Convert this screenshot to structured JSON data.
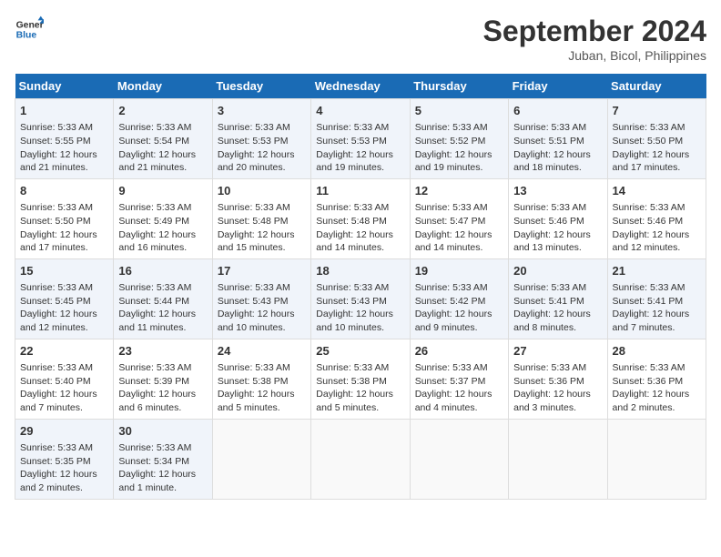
{
  "header": {
    "logo_line1": "General",
    "logo_line2": "Blue",
    "title": "September 2024",
    "subtitle": "Juban, Bicol, Philippines"
  },
  "calendar": {
    "days_of_week": [
      "Sunday",
      "Monday",
      "Tuesday",
      "Wednesday",
      "Thursday",
      "Friday",
      "Saturday"
    ],
    "weeks": [
      [
        null,
        {
          "day": "2",
          "sunrise": "Sunrise: 5:33 AM",
          "sunset": "Sunset: 5:54 PM",
          "daylight": "Daylight: 12 hours and 21 minutes."
        },
        {
          "day": "3",
          "sunrise": "Sunrise: 5:33 AM",
          "sunset": "Sunset: 5:53 PM",
          "daylight": "Daylight: 12 hours and 20 minutes."
        },
        {
          "day": "4",
          "sunrise": "Sunrise: 5:33 AM",
          "sunset": "Sunset: 5:53 PM",
          "daylight": "Daylight: 12 hours and 19 minutes."
        },
        {
          "day": "5",
          "sunrise": "Sunrise: 5:33 AM",
          "sunset": "Sunset: 5:52 PM",
          "daylight": "Daylight: 12 hours and 19 minutes."
        },
        {
          "day": "6",
          "sunrise": "Sunrise: 5:33 AM",
          "sunset": "Sunset: 5:51 PM",
          "daylight": "Daylight: 12 hours and 18 minutes."
        },
        {
          "day": "7",
          "sunrise": "Sunrise: 5:33 AM",
          "sunset": "Sunset: 5:50 PM",
          "daylight": "Daylight: 12 hours and 17 minutes."
        }
      ],
      [
        {
          "day": "1",
          "sunrise": "Sunrise: 5:33 AM",
          "sunset": "Sunset: 5:55 PM",
          "daylight": "Daylight: 12 hours and 21 minutes."
        },
        {
          "day": "9",
          "sunrise": "Sunrise: 5:33 AM",
          "sunset": "Sunset: 5:49 PM",
          "daylight": "Daylight: 12 hours and 16 minutes."
        },
        {
          "day": "10",
          "sunrise": "Sunrise: 5:33 AM",
          "sunset": "Sunset: 5:48 PM",
          "daylight": "Daylight: 12 hours and 15 minutes."
        },
        {
          "day": "11",
          "sunrise": "Sunrise: 5:33 AM",
          "sunset": "Sunset: 5:48 PM",
          "daylight": "Daylight: 12 hours and 14 minutes."
        },
        {
          "day": "12",
          "sunrise": "Sunrise: 5:33 AM",
          "sunset": "Sunset: 5:47 PM",
          "daylight": "Daylight: 12 hours and 14 minutes."
        },
        {
          "day": "13",
          "sunrise": "Sunrise: 5:33 AM",
          "sunset": "Sunset: 5:46 PM",
          "daylight": "Daylight: 12 hours and 13 minutes."
        },
        {
          "day": "14",
          "sunrise": "Sunrise: 5:33 AM",
          "sunset": "Sunset: 5:46 PM",
          "daylight": "Daylight: 12 hours and 12 minutes."
        }
      ],
      [
        {
          "day": "8",
          "sunrise": "Sunrise: 5:33 AM",
          "sunset": "Sunset: 5:50 PM",
          "daylight": "Daylight: 12 hours and 17 minutes."
        },
        {
          "day": "16",
          "sunrise": "Sunrise: 5:33 AM",
          "sunset": "Sunset: 5:44 PM",
          "daylight": "Daylight: 12 hours and 11 minutes."
        },
        {
          "day": "17",
          "sunrise": "Sunrise: 5:33 AM",
          "sunset": "Sunset: 5:43 PM",
          "daylight": "Daylight: 12 hours and 10 minutes."
        },
        {
          "day": "18",
          "sunrise": "Sunrise: 5:33 AM",
          "sunset": "Sunset: 5:43 PM",
          "daylight": "Daylight: 12 hours and 10 minutes."
        },
        {
          "day": "19",
          "sunrise": "Sunrise: 5:33 AM",
          "sunset": "Sunset: 5:42 PM",
          "daylight": "Daylight: 12 hours and 9 minutes."
        },
        {
          "day": "20",
          "sunrise": "Sunrise: 5:33 AM",
          "sunset": "Sunset: 5:41 PM",
          "daylight": "Daylight: 12 hours and 8 minutes."
        },
        {
          "day": "21",
          "sunrise": "Sunrise: 5:33 AM",
          "sunset": "Sunset: 5:41 PM",
          "daylight": "Daylight: 12 hours and 7 minutes."
        }
      ],
      [
        {
          "day": "15",
          "sunrise": "Sunrise: 5:33 AM",
          "sunset": "Sunset: 5:45 PM",
          "daylight": "Daylight: 12 hours and 12 minutes."
        },
        {
          "day": "23",
          "sunrise": "Sunrise: 5:33 AM",
          "sunset": "Sunset: 5:39 PM",
          "daylight": "Daylight: 12 hours and 6 minutes."
        },
        {
          "day": "24",
          "sunrise": "Sunrise: 5:33 AM",
          "sunset": "Sunset: 5:38 PM",
          "daylight": "Daylight: 12 hours and 5 minutes."
        },
        {
          "day": "25",
          "sunrise": "Sunrise: 5:33 AM",
          "sunset": "Sunset: 5:38 PM",
          "daylight": "Daylight: 12 hours and 5 minutes."
        },
        {
          "day": "26",
          "sunrise": "Sunrise: 5:33 AM",
          "sunset": "Sunset: 5:37 PM",
          "daylight": "Daylight: 12 hours and 4 minutes."
        },
        {
          "day": "27",
          "sunrise": "Sunrise: 5:33 AM",
          "sunset": "Sunset: 5:36 PM",
          "daylight": "Daylight: 12 hours and 3 minutes."
        },
        {
          "day": "28",
          "sunrise": "Sunrise: 5:33 AM",
          "sunset": "Sunset: 5:36 PM",
          "daylight": "Daylight: 12 hours and 2 minutes."
        }
      ],
      [
        {
          "day": "22",
          "sunrise": "Sunrise: 5:33 AM",
          "sunset": "Sunset: 5:40 PM",
          "daylight": "Daylight: 12 hours and 7 minutes."
        },
        {
          "day": "30",
          "sunrise": "Sunrise: 5:33 AM",
          "sunset": "Sunset: 5:34 PM",
          "daylight": "Daylight: 12 hours and 1 minute."
        },
        null,
        null,
        null,
        null,
        null
      ],
      [
        {
          "day": "29",
          "sunrise": "Sunrise: 5:33 AM",
          "sunset": "Sunset: 5:35 PM",
          "daylight": "Daylight: 12 hours and 2 minutes."
        },
        null,
        null,
        null,
        null,
        null,
        null
      ]
    ],
    "week_day_1": [
      1,
      9,
      8,
      15,
      22,
      29
    ]
  }
}
